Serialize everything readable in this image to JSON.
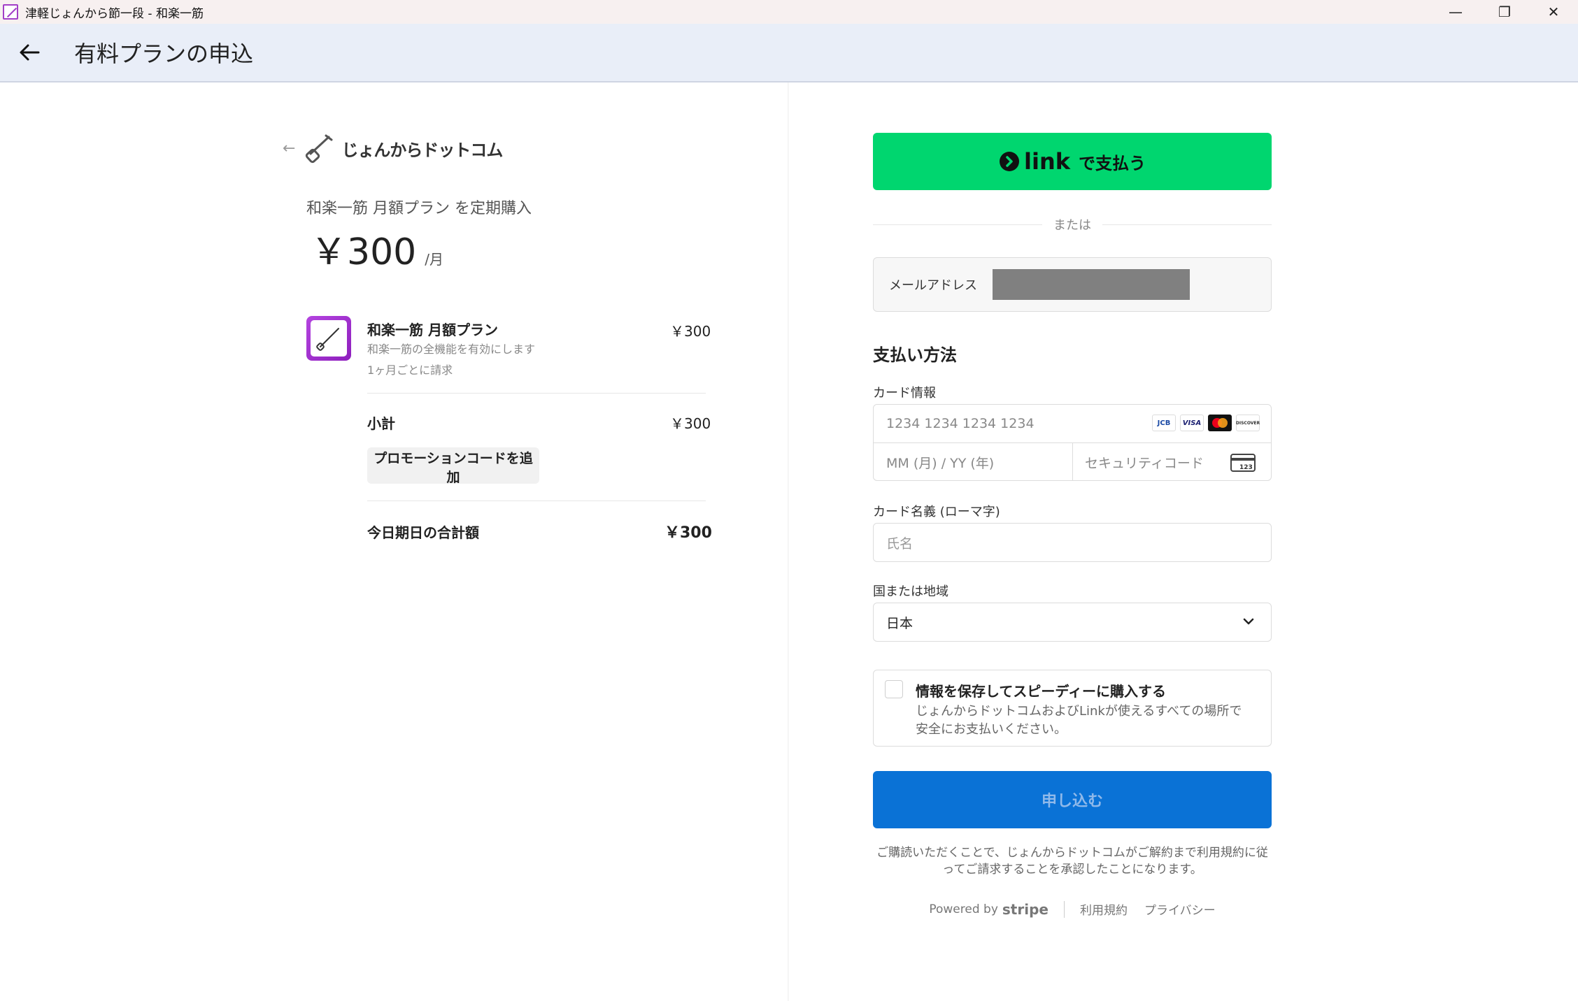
{
  "window": {
    "title": "津軽じょんから節一段 - 和楽一筋",
    "controls": {
      "minimize": "—",
      "maximize": "❐",
      "close": "✕"
    }
  },
  "header": {
    "title": "有料プランの申込"
  },
  "summary": {
    "brand": "じょんからドットコム",
    "plan_title": "和楽一筋 月額プラン を定期購入",
    "price": "￥300",
    "price_unit": "/月",
    "item": {
      "name": "和楽一筋 月額プラン",
      "description": "和楽一筋の全機能を有効にします",
      "billing": "1ヶ月ごとに請求",
      "price": "￥300"
    },
    "subtotal_label": "小計",
    "subtotal_value": "￥300",
    "promo_label": "プロモーションコードを追加",
    "total_label": "今日期日の合計額",
    "total_value": "￥300"
  },
  "payment": {
    "link_word": "link",
    "link_label": "で支払う",
    "or": "または",
    "email_label": "メールアドレス",
    "section_title": "支払い方法",
    "card_info_label": "カード情報",
    "card_number_placeholder": "1234 1234 1234 1234",
    "expiry_placeholder": "MM (月) / YY (年)",
    "cvc_placeholder": "セキュリティコード",
    "card_brands": [
      "JCB",
      "VISA",
      "MC",
      "DISCOVER"
    ],
    "cvc_icon_text": "123",
    "name_label": "カード名義 (ローマ字)",
    "name_placeholder": "氏名",
    "country_label": "国または地域",
    "country_value": "日本",
    "save_title": "情報を保存してスピーディーに購入する",
    "save_desc": "じょんからドットコムおよびLinkが使えるすべての場所で安全にお支払いください。",
    "submit_label": "申し込む",
    "terms": "ご購読いただくことで、じょんからドットコムがご解約まで利用規約に従ってご請求することを承認したことになります。",
    "powered_by": "Powered by",
    "stripe": "stripe",
    "terms_link": "利用規約",
    "privacy_link": "プライバシー"
  },
  "colors": {
    "link_green": "#00d66f",
    "submit_blue": "#0a72d6",
    "accent_purple": "#a23ec7"
  }
}
